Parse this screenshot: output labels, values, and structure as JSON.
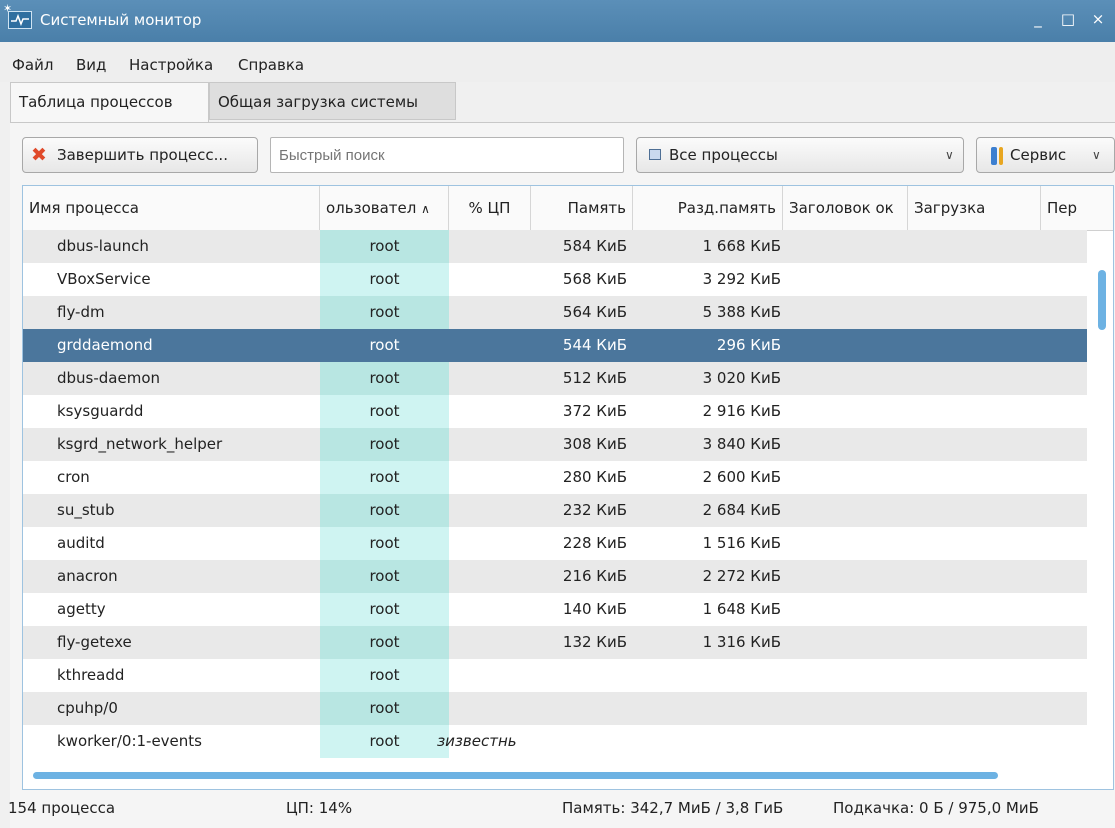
{
  "window": {
    "title": "Системный монитор",
    "minimize": "_",
    "maximize": "□",
    "close": "×"
  },
  "menu": [
    "Файл",
    "Вид",
    "Настройка",
    "Справка"
  ],
  "tabs": [
    "Таблица процессов",
    "Общая загрузка системы"
  ],
  "toolbar": {
    "end_process": "Завершить процесс...",
    "search_placeholder": "Быстрый поиск",
    "filter_selected": "Все процессы",
    "tools": "Сервис"
  },
  "columns": [
    "Имя процесса",
    "ользовател",
    "% ЦП",
    "Память",
    "Разд.память",
    "Заголовок ок",
    "Загрузка",
    "Пер"
  ],
  "processes": [
    {
      "name": "dbus-launch",
      "user": "root",
      "cpu": "",
      "mem": "584 КиБ",
      "shared": "1 668 КиБ"
    },
    {
      "name": "VBoxService",
      "user": "root",
      "cpu": "",
      "mem": "568 КиБ",
      "shared": "3 292 КиБ"
    },
    {
      "name": "fly-dm",
      "user": "root",
      "cpu": "",
      "mem": "564 КиБ",
      "shared": "5 388 КиБ"
    },
    {
      "name": "grddaemond",
      "user": "root",
      "cpu": "",
      "mem": "544 КиБ",
      "shared": "296 КиБ"
    },
    {
      "name": "dbus-daemon",
      "user": "root",
      "cpu": "",
      "mem": "512 КиБ",
      "shared": "3 020 КиБ"
    },
    {
      "name": "ksysguardd",
      "user": "root",
      "cpu": "",
      "mem": "372 КиБ",
      "shared": "2 916 КиБ"
    },
    {
      "name": "ksgrd_network_helper",
      "user": "root",
      "cpu": "",
      "mem": "308 КиБ",
      "shared": "3 840 КиБ"
    },
    {
      "name": "cron",
      "user": "root",
      "cpu": "",
      "mem": "280 КиБ",
      "shared": "2 600 КиБ"
    },
    {
      "name": "su_stub",
      "user": "root",
      "cpu": "",
      "mem": "232 КиБ",
      "shared": "2 684 КиБ"
    },
    {
      "name": "auditd",
      "user": "root",
      "cpu": "",
      "mem": "228 КиБ",
      "shared": "1 516 КиБ"
    },
    {
      "name": "anacron",
      "user": "root",
      "cpu": "",
      "mem": "216 КиБ",
      "shared": "2 272 КиБ"
    },
    {
      "name": "agetty",
      "user": "root",
      "cpu": "",
      "mem": "140 КиБ",
      "shared": "1 648 КиБ"
    },
    {
      "name": "fly-getexe",
      "user": "root",
      "cpu": "",
      "mem": "132 КиБ",
      "shared": "1 316 КиБ"
    },
    {
      "name": "kthreadd",
      "user": "root",
      "cpu": "",
      "mem": "",
      "shared": ""
    },
    {
      "name": "cpuhp/0",
      "user": "root",
      "cpu": "",
      "mem": "",
      "shared": ""
    },
    {
      "name": "kworker/0:1-events",
      "user": "root",
      "cpu": "ɜизвестнь",
      "mem": "",
      "shared": ""
    }
  ],
  "selected_row": 3,
  "status": {
    "processes": "154 процесса",
    "cpu": "ЦП: 14%",
    "memory": "Память: 342,7 МиБ / 3,8 ГиБ",
    "swap": "Подкачка: 0 Б / 975,0 МиБ"
  },
  "colors": {
    "title_bar": "#4a7fa9",
    "selection": "#4b769c",
    "user_column": "#cff4f2",
    "scrollbar": "#6db2e3"
  },
  "icons": [
    "monitor-app-icon",
    "end-process-icon",
    "filter-list-icon",
    "tools-icon",
    "chevron-down-icon",
    "sort-ascending-icon"
  ]
}
